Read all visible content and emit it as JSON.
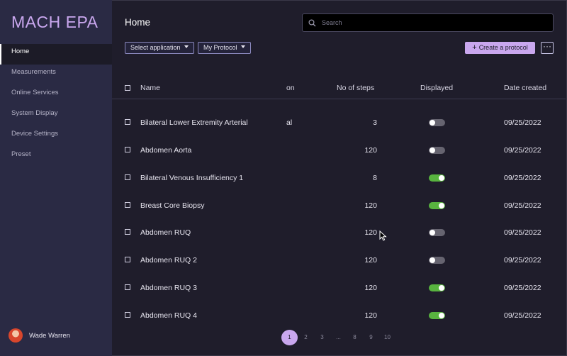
{
  "app": {
    "brand": "MACH EPA"
  },
  "sidebar": {
    "items": [
      {
        "label": "Home",
        "active": true
      },
      {
        "label": "Measurements"
      },
      {
        "label": "Online Services"
      },
      {
        "label": "System Display"
      },
      {
        "label": "Device Settings"
      },
      {
        "label": "Preset"
      }
    ],
    "user": {
      "name": "Wade Warren"
    }
  },
  "header": {
    "title": "Home",
    "search_placeholder": "Search",
    "select_application": "Select application",
    "my_protocol": "My Protocol",
    "create_protocol": "Create a protocol",
    "more": "···"
  },
  "table": {
    "columns": {
      "name": "Name",
      "application_fragment": "on",
      "steps": "No of steps",
      "displayed": "Displayed",
      "date": "Date created"
    },
    "rows": [
      {
        "name": "Bilateral Lower Extremity Arterial",
        "application_fragment": "al",
        "steps": "3",
        "displayed": false,
        "date": "09/25/2022"
      },
      {
        "name": "Abdomen Aorta",
        "steps": "120",
        "displayed": false,
        "date": "09/25/2022"
      },
      {
        "name": "Bilateral Venous Insufficiency 1",
        "steps": "8",
        "displayed": true,
        "date": "09/25/2022"
      },
      {
        "name": "Breast Core Biopsy",
        "steps": "120",
        "displayed": true,
        "date": "09/25/2022"
      },
      {
        "name": "Abdomen RUQ",
        "steps": "120",
        "displayed": false,
        "date": "09/25/2022"
      },
      {
        "name": "Abdomen RUQ 2",
        "steps": "120",
        "displayed": false,
        "date": "09/25/2022"
      },
      {
        "name": "Abdomen RUQ 3",
        "steps": "120",
        "displayed": true,
        "date": "09/25/2022"
      },
      {
        "name": "Abdomen RUQ 4",
        "steps": "120",
        "displayed": true,
        "date": "09/25/2022"
      }
    ]
  },
  "pagination": {
    "pages": [
      "1",
      "2",
      "3",
      "...",
      "8",
      "9",
      "10"
    ],
    "current": "1"
  },
  "colors": {
    "accent": "#c9a7ee",
    "toggle_on": "#58b33f",
    "toggle_off": "#666470",
    "sidebar": "#2a2a44",
    "background": "#1f1d2b"
  },
  "icons": {
    "search": "search-icon",
    "plus": "plus-icon",
    "more": "more-icon",
    "caret": "chevron-down-icon"
  }
}
